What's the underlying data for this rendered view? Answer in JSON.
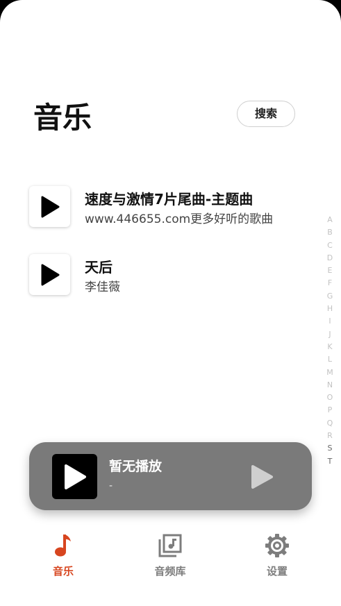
{
  "header": {
    "title": "音乐",
    "search_label": "搜索"
  },
  "songs": [
    {
      "title": "速度与激情7片尾曲-主题曲",
      "artist": "www.446655.com更多好听的歌曲",
      "icon": "play-icon"
    },
    {
      "title": "天后",
      "artist": "李佳薇",
      "icon": "play-icon"
    }
  ],
  "alphabet": [
    "A",
    "B",
    "C",
    "D",
    "E",
    "F",
    "G",
    "H",
    "I",
    "J",
    "K",
    "L",
    "M",
    "N",
    "O",
    "P",
    "Q",
    "R",
    "S",
    "T"
  ],
  "player": {
    "now_playing": "暂无播放",
    "subtitle": "-"
  },
  "tabs": [
    {
      "label": "音乐",
      "icon": "music-note-icon",
      "active": true
    },
    {
      "label": "音频库",
      "icon": "audio-library-icon",
      "active": false
    },
    {
      "label": "设置",
      "icon": "gear-icon",
      "active": false
    }
  ],
  "colors": {
    "accent": "#d7451f",
    "inactive": "#7d7d7d",
    "player_bg": "#7a7a7a"
  }
}
